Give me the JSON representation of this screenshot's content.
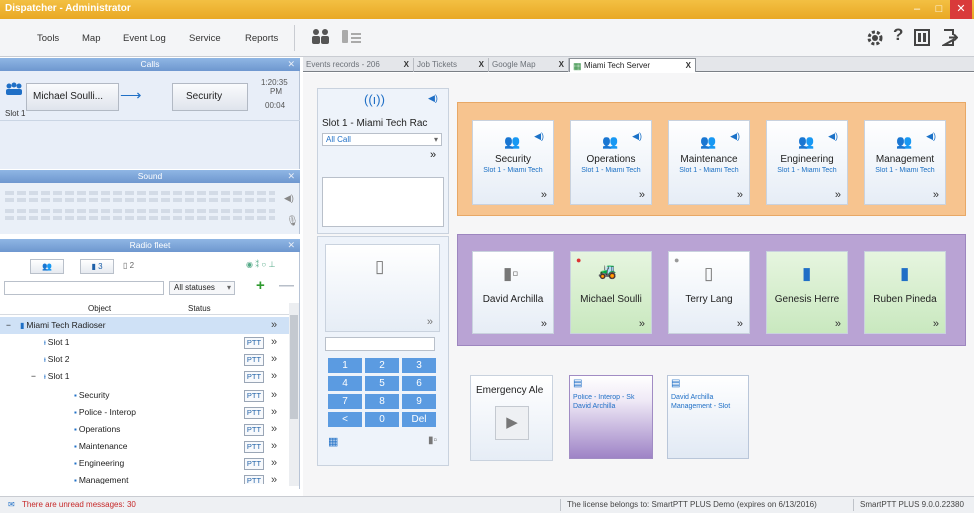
{
  "window": {
    "title": "Dispatcher - Administrator",
    "min": "–",
    "max": "□",
    "close": "✕"
  },
  "menu": [
    "Tools",
    "Map",
    "Event Log",
    "Service",
    "Reports"
  ],
  "tabs": [
    {
      "label": "Events records - 206",
      "close": "X"
    },
    {
      "label": "Job Tickets",
      "close": "X"
    },
    {
      "label": "Google Map",
      "close": "X"
    },
    {
      "label": "Miami Tech Server",
      "close": "X"
    }
  ],
  "calls": {
    "header": "Calls",
    "caller": "Michael Soulli...",
    "target": "Security",
    "time": "1:20:35",
    "ampm": "PM",
    "duration": "00:04",
    "slot": "Slot 1"
  },
  "sound": {
    "header": "Sound"
  },
  "fleet": {
    "header": "Radio fleet",
    "btn_counts": [
      "",
      "3",
      "2"
    ],
    "status_filter": "All statuses",
    "col_object": "Object",
    "col_status": "Status",
    "rows": [
      {
        "label": "Miami Tech Radioser",
        "ptt": ""
      },
      {
        "label": "Slot 1",
        "ptt": "PTT"
      },
      {
        "label": "Slot 2",
        "ptt": "PTT"
      },
      {
        "label": "Slot 1",
        "ptt": "PTT"
      },
      {
        "label": "Security",
        "ptt": "PTT"
      },
      {
        "label": "Police - Interop",
        "ptt": "PTT"
      },
      {
        "label": "Operations",
        "ptt": "PTT"
      },
      {
        "label": "Maintenance",
        "ptt": "PTT"
      },
      {
        "label": "Engineering",
        "ptt": "PTT"
      },
      {
        "label": "Management",
        "ptt": "PTT"
      }
    ]
  },
  "channel": {
    "name": "Slot 1 - Miami Tech Rac",
    "select": "All Call"
  },
  "keypad": [
    "1",
    "2",
    "3",
    "4",
    "5",
    "6",
    "7",
    "8",
    "9",
    "<",
    "0",
    "Del"
  ],
  "talkgroups": [
    {
      "name": "Security",
      "sub": "Slot 1 - Miami Tech"
    },
    {
      "name": "Operations",
      "sub": "Slot 1 - Miami Tech"
    },
    {
      "name": "Maintenance",
      "sub": "Slot 1 - Miami Tech"
    },
    {
      "name": "Engineering",
      "sub": "Slot 1 - Miami Tech"
    },
    {
      "name": "Management",
      "sub": "Slot 1 - Miami Tech"
    }
  ],
  "radios": [
    {
      "name": "David Archilla",
      "state": "offline"
    },
    {
      "name": "Michael Soulli",
      "state": "online"
    },
    {
      "name": "Terry Lang",
      "state": "offline"
    },
    {
      "name": "Genesis Herre",
      "state": "online"
    },
    {
      "name": "Ruben Pineda",
      "state": "online"
    }
  ],
  "emergency": {
    "label": "Emergency Ale"
  },
  "notes": [
    {
      "line1": "Police - Interop - Sk",
      "line2": "David Archilla"
    },
    {
      "line1": "David Archilla",
      "line2": "Management - Slot"
    }
  ],
  "status": {
    "messages": "There are unread messages: 30",
    "license": "The license belongs to:  SmartPTT PLUS Demo (expires on 6/13/2016)",
    "version": "SmartPTT PLUS 9.0.0.22380"
  },
  "colors": {
    "talk_group_bg": "#f7c48f",
    "radio_group_bg": "#b9a3d4",
    "online_bg": "#c9e8bf",
    "accent": "#1f6fc6"
  }
}
